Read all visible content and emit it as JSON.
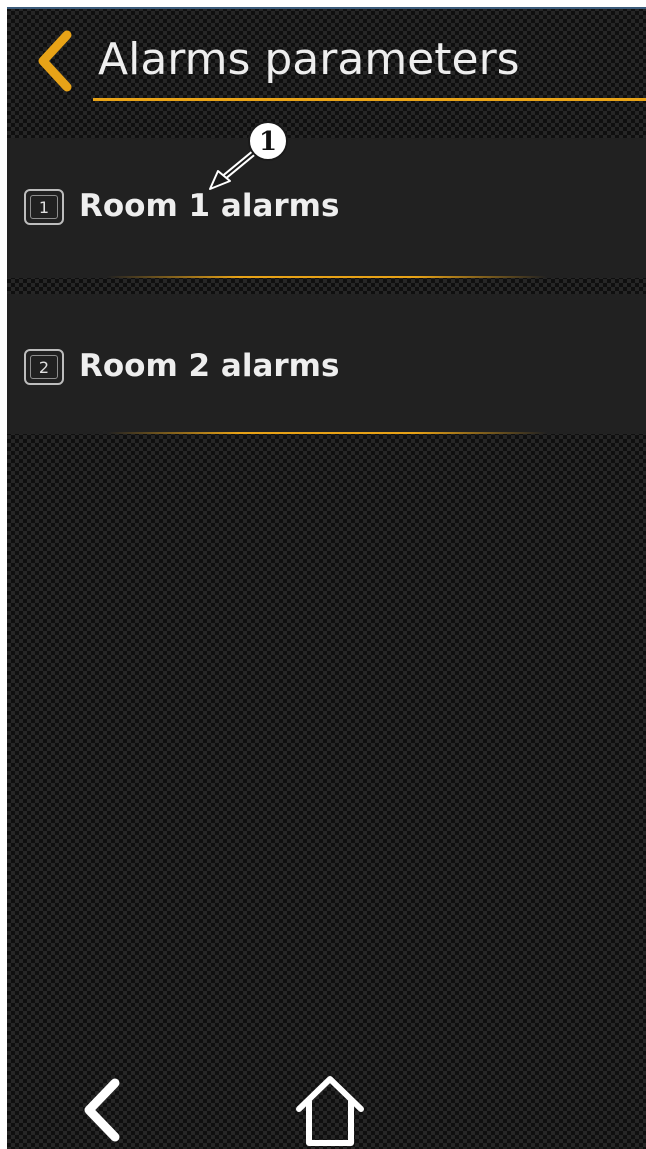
{
  "header": {
    "title": "Alarms parameters",
    "back_icon": "chevron-left-icon"
  },
  "menu": {
    "items": [
      {
        "number": "1",
        "label": "Room 1 alarms"
      },
      {
        "number": "2",
        "label": "Room 2 alarms"
      }
    ]
  },
  "annotation": {
    "callout_number": "1"
  },
  "bottom_nav": {
    "back_icon": "back-arrow-icon",
    "home_icon": "home-icon"
  },
  "colors": {
    "accent": "#e8a317",
    "item_background": "#212121",
    "text": "#eeeeee"
  }
}
